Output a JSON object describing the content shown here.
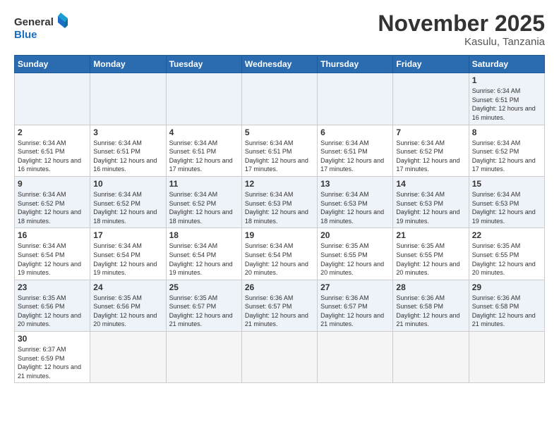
{
  "header": {
    "logo_general": "General",
    "logo_blue": "Blue",
    "month_title": "November 2025",
    "location": "Kasulu, Tanzania"
  },
  "days_of_week": [
    "Sunday",
    "Monday",
    "Tuesday",
    "Wednesday",
    "Thursday",
    "Friday",
    "Saturday"
  ],
  "weeks": [
    [
      {
        "num": "",
        "info": ""
      },
      {
        "num": "",
        "info": ""
      },
      {
        "num": "",
        "info": ""
      },
      {
        "num": "",
        "info": ""
      },
      {
        "num": "",
        "info": ""
      },
      {
        "num": "",
        "info": ""
      },
      {
        "num": "1",
        "info": "Sunrise: 6:34 AM\nSunset: 6:51 PM\nDaylight: 12 hours and 16 minutes."
      }
    ],
    [
      {
        "num": "2",
        "info": "Sunrise: 6:34 AM\nSunset: 6:51 PM\nDaylight: 12 hours and 16 minutes."
      },
      {
        "num": "3",
        "info": "Sunrise: 6:34 AM\nSunset: 6:51 PM\nDaylight: 12 hours and 16 minutes."
      },
      {
        "num": "4",
        "info": "Sunrise: 6:34 AM\nSunset: 6:51 PM\nDaylight: 12 hours and 17 minutes."
      },
      {
        "num": "5",
        "info": "Sunrise: 6:34 AM\nSunset: 6:51 PM\nDaylight: 12 hours and 17 minutes."
      },
      {
        "num": "6",
        "info": "Sunrise: 6:34 AM\nSunset: 6:51 PM\nDaylight: 12 hours and 17 minutes."
      },
      {
        "num": "7",
        "info": "Sunrise: 6:34 AM\nSunset: 6:52 PM\nDaylight: 12 hours and 17 minutes."
      },
      {
        "num": "8",
        "info": "Sunrise: 6:34 AM\nSunset: 6:52 PM\nDaylight: 12 hours and 17 minutes."
      }
    ],
    [
      {
        "num": "9",
        "info": "Sunrise: 6:34 AM\nSunset: 6:52 PM\nDaylight: 12 hours and 18 minutes."
      },
      {
        "num": "10",
        "info": "Sunrise: 6:34 AM\nSunset: 6:52 PM\nDaylight: 12 hours and 18 minutes."
      },
      {
        "num": "11",
        "info": "Sunrise: 6:34 AM\nSunset: 6:52 PM\nDaylight: 12 hours and 18 minutes."
      },
      {
        "num": "12",
        "info": "Sunrise: 6:34 AM\nSunset: 6:53 PM\nDaylight: 12 hours and 18 minutes."
      },
      {
        "num": "13",
        "info": "Sunrise: 6:34 AM\nSunset: 6:53 PM\nDaylight: 12 hours and 18 minutes."
      },
      {
        "num": "14",
        "info": "Sunrise: 6:34 AM\nSunset: 6:53 PM\nDaylight: 12 hours and 19 minutes."
      },
      {
        "num": "15",
        "info": "Sunrise: 6:34 AM\nSunset: 6:53 PM\nDaylight: 12 hours and 19 minutes."
      }
    ],
    [
      {
        "num": "16",
        "info": "Sunrise: 6:34 AM\nSunset: 6:54 PM\nDaylight: 12 hours and 19 minutes."
      },
      {
        "num": "17",
        "info": "Sunrise: 6:34 AM\nSunset: 6:54 PM\nDaylight: 12 hours and 19 minutes."
      },
      {
        "num": "18",
        "info": "Sunrise: 6:34 AM\nSunset: 6:54 PM\nDaylight: 12 hours and 19 minutes."
      },
      {
        "num": "19",
        "info": "Sunrise: 6:34 AM\nSunset: 6:54 PM\nDaylight: 12 hours and 20 minutes."
      },
      {
        "num": "20",
        "info": "Sunrise: 6:35 AM\nSunset: 6:55 PM\nDaylight: 12 hours and 20 minutes."
      },
      {
        "num": "21",
        "info": "Sunrise: 6:35 AM\nSunset: 6:55 PM\nDaylight: 12 hours and 20 minutes."
      },
      {
        "num": "22",
        "info": "Sunrise: 6:35 AM\nSunset: 6:55 PM\nDaylight: 12 hours and 20 minutes."
      }
    ],
    [
      {
        "num": "23",
        "info": "Sunrise: 6:35 AM\nSunset: 6:56 PM\nDaylight: 12 hours and 20 minutes."
      },
      {
        "num": "24",
        "info": "Sunrise: 6:35 AM\nSunset: 6:56 PM\nDaylight: 12 hours and 20 minutes."
      },
      {
        "num": "25",
        "info": "Sunrise: 6:35 AM\nSunset: 6:57 PM\nDaylight: 12 hours and 21 minutes."
      },
      {
        "num": "26",
        "info": "Sunrise: 6:36 AM\nSunset: 6:57 PM\nDaylight: 12 hours and 21 minutes."
      },
      {
        "num": "27",
        "info": "Sunrise: 6:36 AM\nSunset: 6:57 PM\nDaylight: 12 hours and 21 minutes."
      },
      {
        "num": "28",
        "info": "Sunrise: 6:36 AM\nSunset: 6:58 PM\nDaylight: 12 hours and 21 minutes."
      },
      {
        "num": "29",
        "info": "Sunrise: 6:36 AM\nSunset: 6:58 PM\nDaylight: 12 hours and 21 minutes."
      }
    ],
    [
      {
        "num": "30",
        "info": "Sunrise: 6:37 AM\nSunset: 6:59 PM\nDaylight: 12 hours and 21 minutes."
      },
      {
        "num": "",
        "info": ""
      },
      {
        "num": "",
        "info": ""
      },
      {
        "num": "",
        "info": ""
      },
      {
        "num": "",
        "info": ""
      },
      {
        "num": "",
        "info": ""
      },
      {
        "num": "",
        "info": ""
      }
    ]
  ]
}
